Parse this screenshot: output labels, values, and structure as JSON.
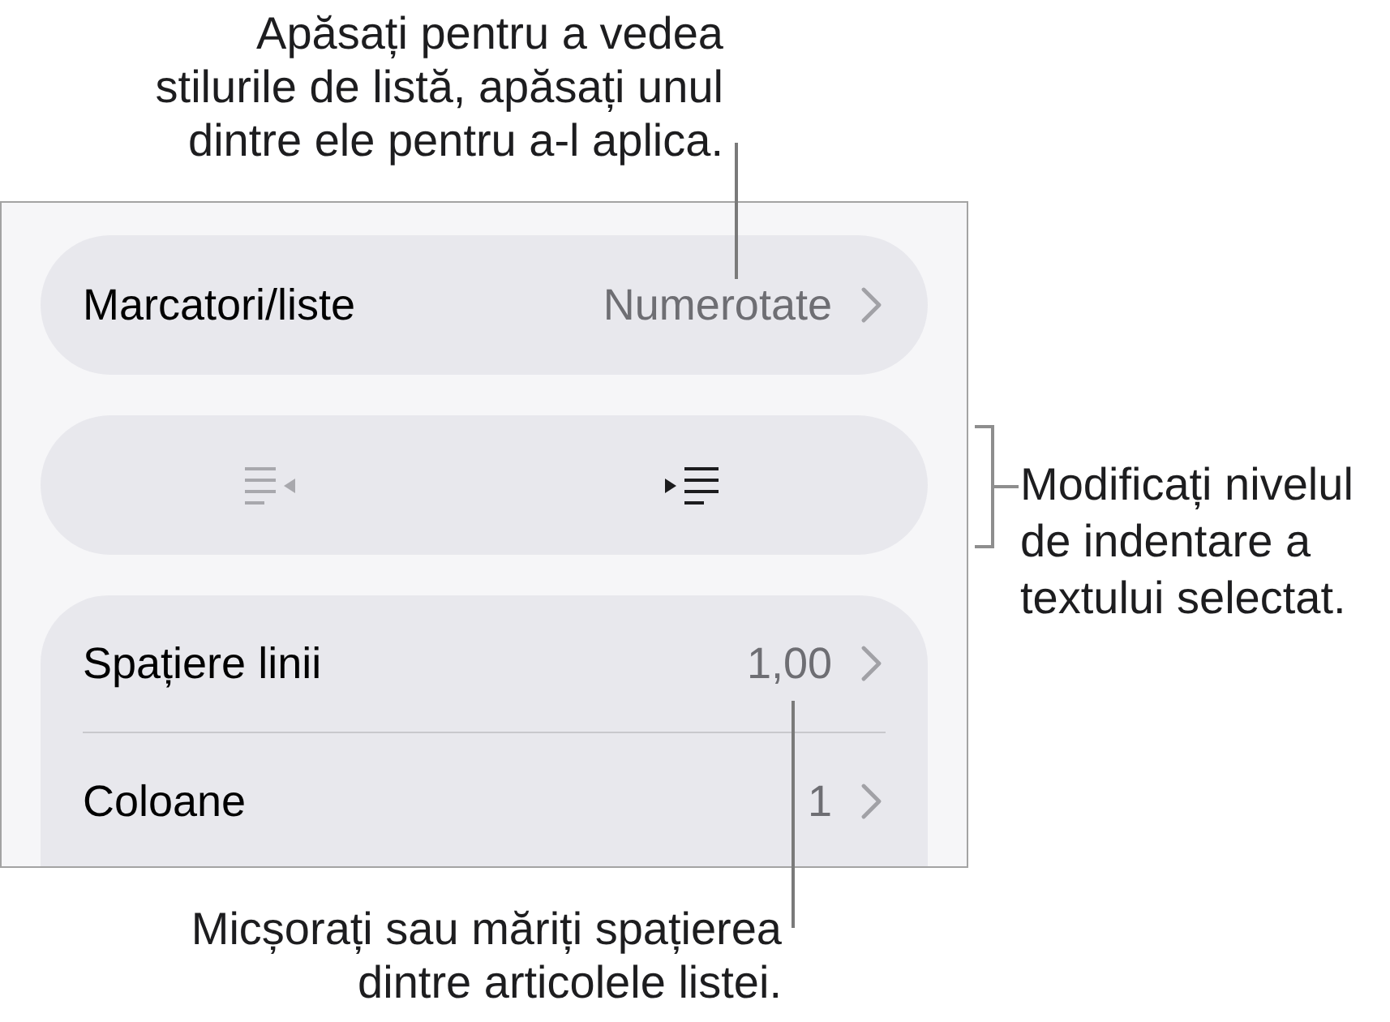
{
  "top_callout": {
    "text": "Apăsați pentru a vedea\nstilurile de listă, apăsați unul\ndintre ele pentru a-l aplica."
  },
  "panel": {
    "list_style_row": {
      "label": "Marcatori/liste",
      "value": "Numerotate"
    },
    "indent_buttons": [
      {
        "kind": "outdent",
        "disabled": true
      },
      {
        "kind": "indent",
        "disabled": false
      }
    ],
    "rows": [
      {
        "label": "Spațiere linii",
        "value": "1,00"
      },
      {
        "label": "Coloane",
        "value": "1"
      }
    ]
  },
  "side_callout": {
    "text": "Modificați nivelul\nde indentare a\ntextului selectat."
  },
  "bottom_callout": {
    "text": "Micșorați sau măriți spațierea\ndintre articolele listei."
  }
}
